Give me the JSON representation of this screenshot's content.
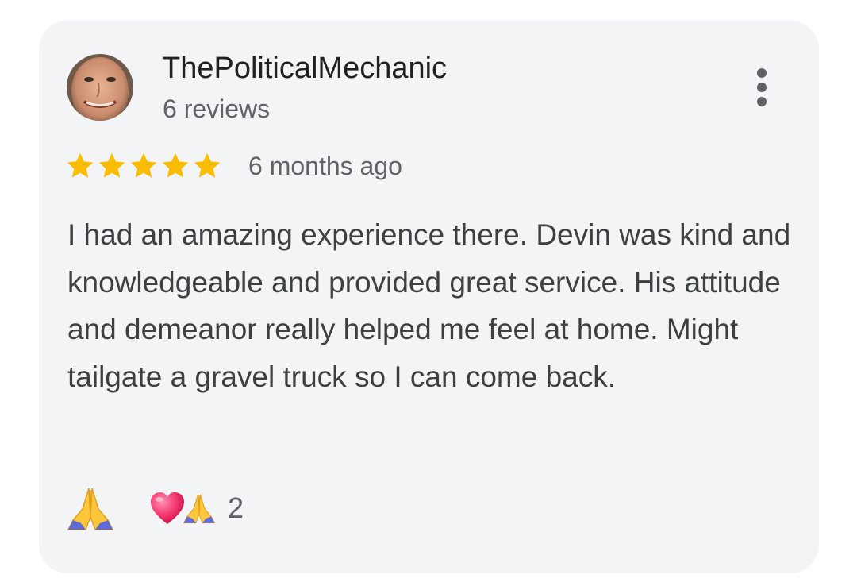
{
  "review": {
    "author": {
      "name": "ThePoliticalMechanic",
      "reviews": "6 reviews",
      "avatar": "profile-photo"
    },
    "rating": 5,
    "rating_max": 5,
    "time": "6 months ago",
    "text": "I had an amazing experience there. Devin was kind and knowledgeable and provided great service. His attitude and demeanor really helped me feel at home. Might tailgate a gravel truck so I can come back.",
    "menu_icon": "more-vert-icon",
    "reactions": {
      "add_reaction_icon": "folded-hands-icon",
      "summary_icons": [
        "heart-icon",
        "folded-hands-icon"
      ],
      "count": "2"
    }
  },
  "colors": {
    "card_background": "#f3f4f6",
    "star": "#fbbc04",
    "primary_text": "#202124",
    "secondary_text": "#5f6368"
  }
}
